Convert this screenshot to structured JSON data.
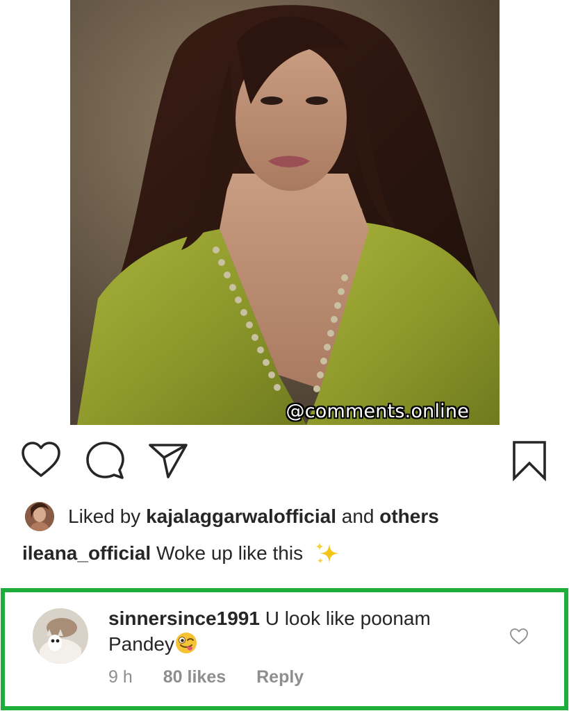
{
  "post": {
    "watermark": "@comments.online",
    "image_subject": "post-photo"
  },
  "actions": {
    "like_icon": "heart-outline-icon",
    "comment_icon": "comment-bubble-icon",
    "share_icon": "paper-plane-icon",
    "save_icon": "bookmark-icon"
  },
  "likes": {
    "prefix": "Liked by ",
    "user": "kajalaggarwalofficial",
    "middle": " and ",
    "others": "others"
  },
  "caption": {
    "username": "ileana_official",
    "text": " Woke up like this ",
    "emoji": "sparkles-icon"
  },
  "comment": {
    "username": "sinnersince1991",
    "text": " U look like poonam Pandey",
    "emoji": "winking-tongue-emoji",
    "time": "9 h",
    "likes": "80 likes",
    "reply": "Reply"
  },
  "colors": {
    "highlight_border": "#1fad3a",
    "meta_text": "#8e8e8e",
    "primary_text": "#262626"
  }
}
